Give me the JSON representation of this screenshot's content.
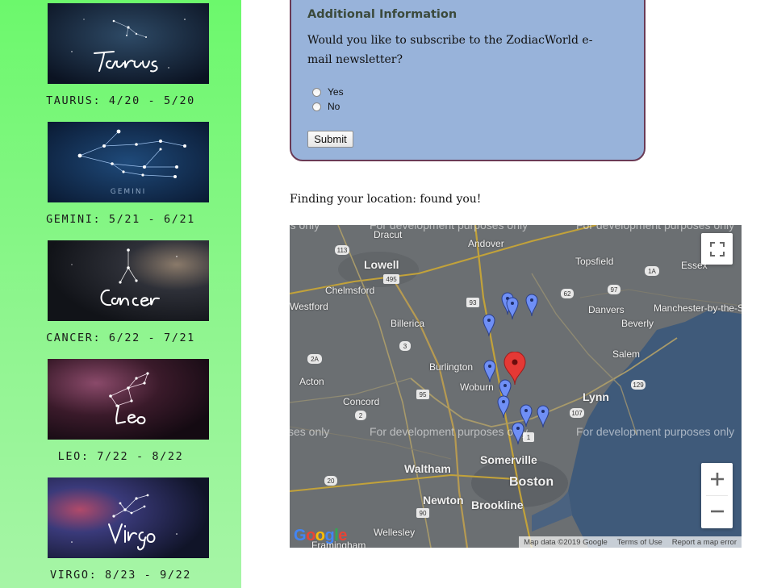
{
  "sidebar": {
    "signs": [
      {
        "name": "Taurus",
        "label": "TAURUS: 4/20 - 5/20"
      },
      {
        "name": "Gemini",
        "label": "GEMINI: 5/21 - 6/21",
        "image_text": "GEMINI"
      },
      {
        "name": "Cancer",
        "label": "CANCER: 6/22 - 7/21"
      },
      {
        "name": "Leo",
        "label": "LEO: 7/22 - 8/22"
      },
      {
        "name": "Virgo",
        "label": "VIRGO: 8/23 - 9/22"
      }
    ],
    "background_color": "#7ff77f"
  },
  "form": {
    "heading": "Additional Information",
    "question": "Would you like to subscribe to the ZodiacWorld e-mail newsletter?",
    "options": [
      {
        "label": "Yes",
        "selected": false
      },
      {
        "label": "No",
        "selected": false
      }
    ],
    "submit_label": "Submit",
    "background_color": "#98b3da",
    "border_color": "#6a3a55"
  },
  "location_status": "Finding your location: found you!",
  "map": {
    "places": {
      "dracut": "Dracut",
      "andover": "Andover",
      "topsfield": "Topsfield",
      "essex": "Essex",
      "lowell": "Lowell",
      "chelmsford": "Chelmsford",
      "westford": "Westford",
      "billerica": "Billerica",
      "danvers": "Danvers",
      "manchester": "Manchester-by-the-S",
      "beverly": "Beverly",
      "salem": "Salem",
      "burlington": "Burlington",
      "acton": "Acton",
      "woburn": "Woburn",
      "lynn": "Lynn",
      "concord": "Concord",
      "waltham": "Waltham",
      "somerville": "Somerville",
      "boston": "Boston",
      "newton": "Newton",
      "brookline": "Brookline",
      "wellesley": "Wellesley",
      "framingham": "Framingham"
    },
    "route_shields": [
      "113",
      "495",
      "93",
      "62",
      "97",
      "1A",
      "3",
      "2A",
      "95",
      "129",
      "2",
      "107",
      "1",
      "20",
      "90"
    ],
    "watermark": "For development purposes only",
    "watermark_fragment_left": "ses only",
    "watermark_fragment_right": "For development purposes only",
    "watermark_top_left": "oses only",
    "attribution": {
      "map_data": "Map data ©2019 Google",
      "terms": "Terms of Use",
      "report": "Report a map error"
    },
    "logo_text": "Google",
    "controls": {
      "fullscreen_icon": "fullscreen-icon",
      "zoom_in": "+",
      "zoom_out": "−"
    },
    "marker_colors": {
      "user": "#e53935",
      "results": "#6f8ff5"
    },
    "result_marker_count": 10
  }
}
